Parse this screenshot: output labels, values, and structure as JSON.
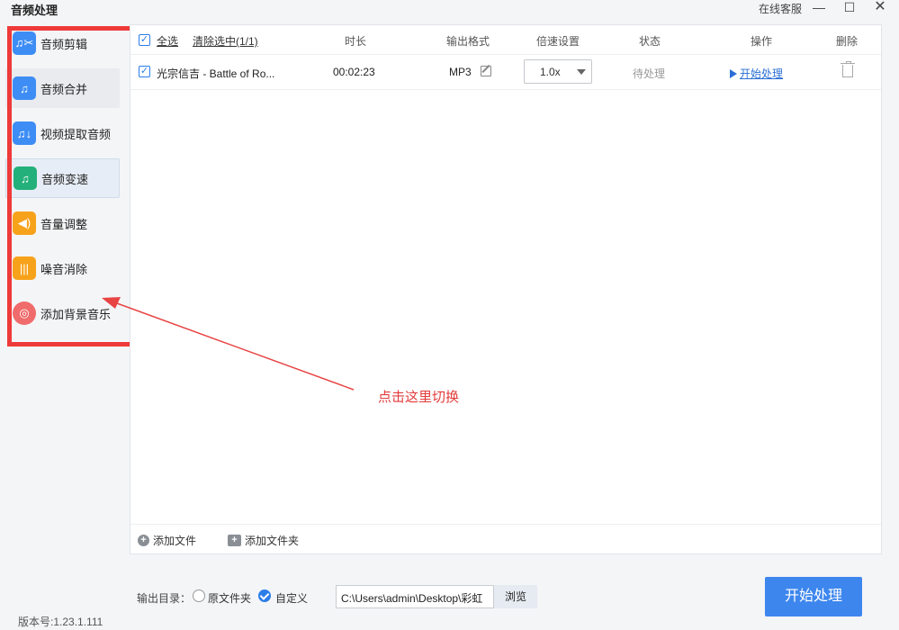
{
  "window": {
    "title": "音频处理",
    "online_service": "在线客服",
    "minimize": "—",
    "maximize": "☐",
    "close": "✕"
  },
  "sidebar": {
    "items": [
      {
        "label": "音频剪辑",
        "icon": "audio-cut-icon",
        "glyph": "♫✂"
      },
      {
        "label": "音频合并",
        "icon": "audio-merge-icon",
        "glyph": "♫"
      },
      {
        "label": "视频提取音频",
        "icon": "video-extract-audio-icon",
        "glyph": "♫↓"
      },
      {
        "label": "音频变速",
        "icon": "audio-speed-icon",
        "glyph": "♫"
      },
      {
        "label": "音量调整",
        "icon": "volume-icon",
        "glyph": "◀)"
      },
      {
        "label": "噪音消除",
        "icon": "noise-reduction-icon",
        "glyph": "|||"
      },
      {
        "label": "添加背景音乐",
        "icon": "background-music-icon",
        "glyph": "◎"
      }
    ]
  },
  "table": {
    "select_all": "全选",
    "clear_selected": "清除选中(1/1)",
    "headers": {
      "duration": "时长",
      "output_format": "输出格式",
      "speed": "倍速设置",
      "status": "状态",
      "action": "操作",
      "delete": "删除"
    },
    "rows": [
      {
        "checked": true,
        "name": "光宗信吉 - Battle of Ro...",
        "duration": "00:02:23",
        "format": "MP3",
        "speed": "1.0x",
        "status": "待处理",
        "action": "开始处理"
      }
    ],
    "add_file": "添加文件",
    "add_folder": "添加文件夹"
  },
  "annotation": {
    "text": "点击这里切换",
    "color": "#e33b3b"
  },
  "output": {
    "label": "输出目录：",
    "option_original": "原文件夹",
    "option_custom": "自定义",
    "selected": "自定义",
    "path": "C:\\Users\\admin\\Desktop\\彩虹",
    "browse": "浏览"
  },
  "start_button": "开始处理",
  "version": "版本号:1.23.1.111",
  "colors": {
    "accent": "#3d86ee",
    "highlight_frame": "#ef3a3a"
  }
}
